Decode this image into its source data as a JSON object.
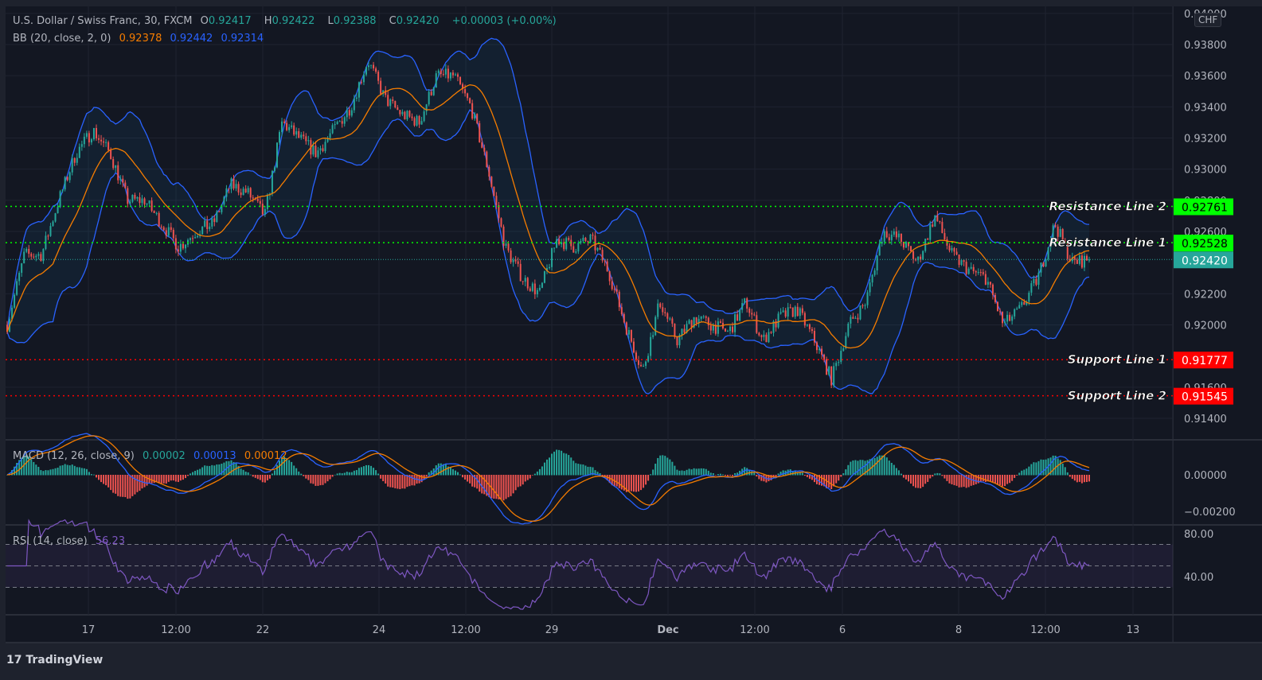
{
  "header": {
    "symbol": "U.S. Dollar / Swiss Franc, 30, FXCM",
    "o_label": "O",
    "o": "0.92417",
    "h_label": "H",
    "h": "0.92422",
    "l_label": "L",
    "l": "0.92388",
    "c_label": "C",
    "c": "0.92420",
    "change": "+0.00003 (+0.00%)",
    "bb_label": "BB (20, close, 2, 0)",
    "bb_basis": "0.92378",
    "bb_upper": "0.92442",
    "bb_lower": "0.92314",
    "macd_label": "MACD (12, 26, close, 9)",
    "macd_hist": "0.00002",
    "macd_line": "0.00013",
    "macd_signal": "0.00012",
    "rsi_label": "RSI (14, close)",
    "rsi_value": "56.23",
    "currency": "CHF"
  },
  "footer": {
    "brand": "TradingView"
  },
  "colors": {
    "up": "#26a69a",
    "down": "#ef5350",
    "bb_basis": "#f57c00",
    "bb_band": "#2962ff",
    "rsi": "#7e57c2",
    "resistance": "#00ff00",
    "support": "#ff0000",
    "last_price": "#26a69a"
  },
  "chart_data": {
    "type": "candlestick",
    "price_axis": {
      "ticks": [
        "0.94000",
        "0.93800",
        "0.93600",
        "0.93400",
        "0.93200",
        "0.93000",
        "0.92800",
        "0.92600",
        "0.92200",
        "0.92000",
        "0.91600",
        "0.91400"
      ],
      "range": [
        0.9134,
        0.9408
      ]
    },
    "time_axis": {
      "ticks": [
        "17",
        "12:00",
        "22",
        "24",
        "12:00",
        "29",
        "Dec",
        "12:00",
        "6",
        "8",
        "12:00",
        "13"
      ]
    },
    "approx_close": [
      0.92,
      0.9245,
      0.9245,
      0.928,
      0.931,
      0.9325,
      0.931,
      0.928,
      0.928,
      0.9265,
      0.925,
      0.926,
      0.9265,
      0.929,
      0.9285,
      0.927,
      0.933,
      0.932,
      0.931,
      0.9325,
      0.934,
      0.937,
      0.9345,
      0.9335,
      0.933,
      0.936,
      0.936,
      0.934,
      0.93,
      0.925,
      0.923,
      0.922,
      0.9255,
      0.925,
      0.9255,
      0.9235,
      0.92,
      0.917,
      0.9215,
      0.919,
      0.9205,
      0.92,
      0.9195,
      0.9215,
      0.919,
      0.9205,
      0.921,
      0.919,
      0.9165,
      0.92,
      0.9215,
      0.926,
      0.9255,
      0.924,
      0.927,
      0.9245,
      0.9235,
      0.923,
      0.92,
      0.921,
      0.923,
      0.9265,
      0.924,
      0.9242
    ],
    "last_price": {
      "value": 0.9242,
      "label": "0.92420"
    },
    "levels": [
      {
        "name": "Resistance Line 2",
        "value": 0.92761,
        "label": "0.92761",
        "kind": "resistance"
      },
      {
        "name": "Resistance Line 1",
        "value": 0.92528,
        "label": "0.92528",
        "kind": "resistance"
      },
      {
        "name": "Support Line 1",
        "value": 0.91777,
        "label": "0.91777",
        "kind": "support"
      },
      {
        "name": "Support Line 2",
        "value": 0.91545,
        "label": "0.91545",
        "kind": "support"
      }
    ],
    "macd_axis": {
      "ticks": [
        "0.00000",
        "−0.00200"
      ]
    },
    "rsi_axis": {
      "ticks": [
        "80.00",
        "40.00"
      ],
      "bands": [
        70,
        30
      ]
    }
  }
}
